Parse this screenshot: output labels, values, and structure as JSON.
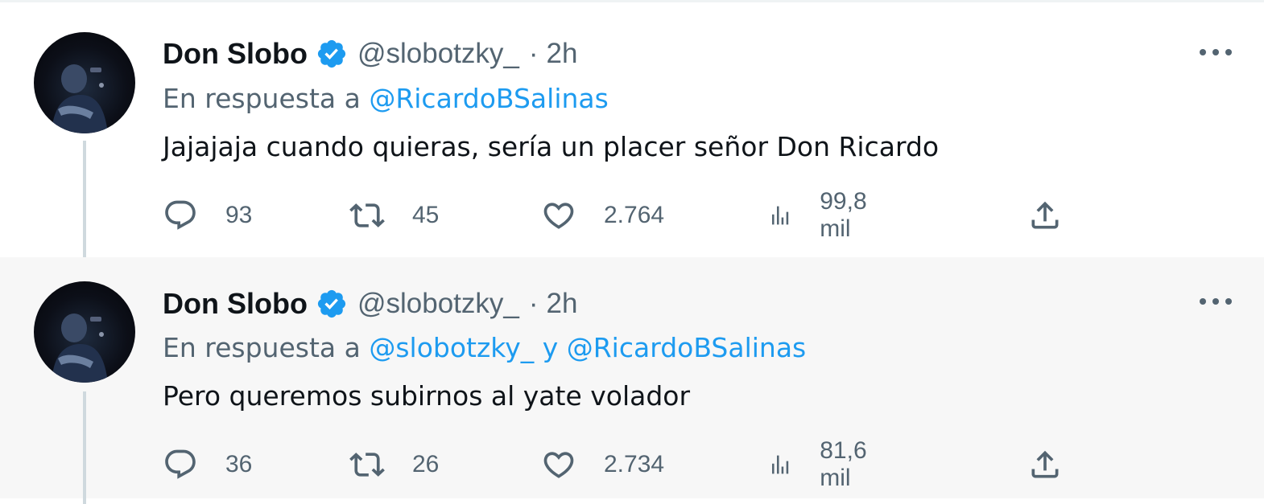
{
  "colors": {
    "accent": "#1d9bf0",
    "muted": "#536471",
    "text": "#0f1419"
  },
  "icons": [
    "verified-badge-icon",
    "more-icon",
    "reply-icon",
    "retweet-icon",
    "like-icon",
    "views-icon",
    "share-icon"
  ],
  "tweets": [
    {
      "name": "Don Slobo",
      "handle": "@slobotzky_",
      "separator": "·",
      "time": "2h",
      "reply_prefix": "En respuesta a",
      "reply_mentions": "@RicardoBSalinas",
      "text": "Jajajaja cuando quieras, sería un placer señor Don Ricardo",
      "replies": "93",
      "retweets": "45",
      "likes": "2.764",
      "views": "99,8 mil"
    },
    {
      "name": "Don Slobo",
      "handle": "@slobotzky_",
      "separator": "·",
      "time": "2h",
      "reply_prefix": "En respuesta a",
      "reply_mentions": "@slobotzky_ y @RicardoBSalinas",
      "text": "Pero queremos subirnos al yate volador",
      "replies": "36",
      "retweets": "26",
      "likes": "2.734",
      "views": "81,6 mil"
    }
  ]
}
